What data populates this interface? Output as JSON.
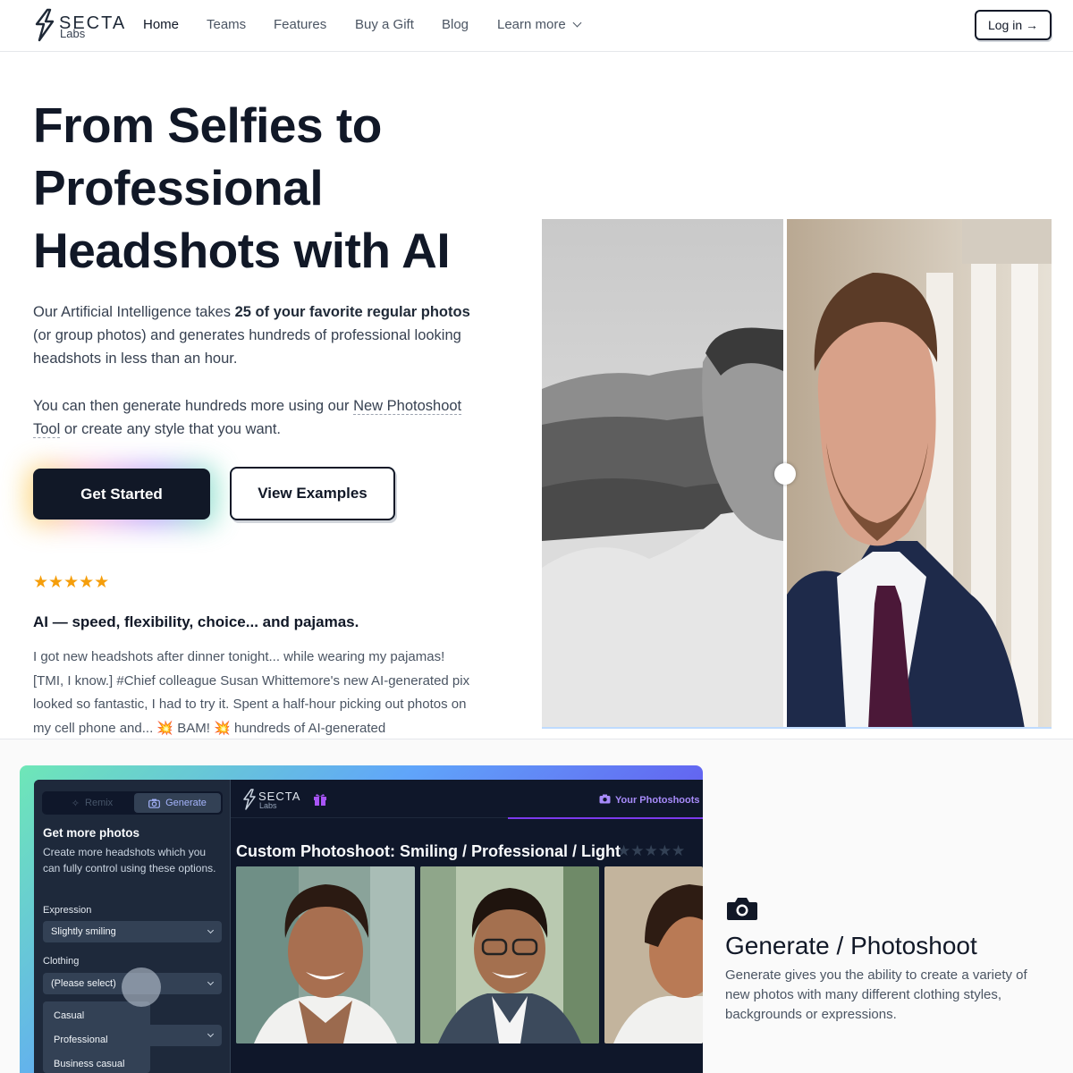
{
  "nav": {
    "logo_name": "SECTA",
    "logo_sub": "Labs",
    "links": [
      "Home",
      "Teams",
      "Features",
      "Buy a Gift",
      "Blog"
    ],
    "learn_more": "Learn more",
    "login": "Log in →"
  },
  "hero": {
    "title_line1": "From Selfies to",
    "title_line2": "Professional",
    "title_line3": "Headshots with AI",
    "p1_pre": "Our Artificial Intelligence takes ",
    "p1_bold": "25 of your favorite regular photos",
    "p1_post": " (or group photos) and generates hundreds of professional looking headshots in less than an hour.",
    "p2_pre": "You can then generate hundreds more using our ",
    "p2_link": "New Photoshoot Tool",
    "p2_post": " or create any style that you want.",
    "cta_primary": "Get Started",
    "cta_secondary": "View Examples"
  },
  "review": {
    "stars": "★★★★★",
    "rating": 5,
    "title": "AI — speed, flexibility, choice... and pajamas.",
    "body": "I got new headshots after dinner tonight... while wearing my pajamas! [TMI, I know.] #Chief colleague Susan Whittemore's new AI-generated pix looked so fantastic, I had to try it. Spent a half-hour picking out photos on my cell phone and... 💥 BAM! 💥 hundreds of AI-generated"
  },
  "app_preview": {
    "tab_remix": "Remix",
    "tab_generate": "Generate",
    "sidebar_title": "Get more photos",
    "sidebar_desc": "Create more headshots which you can fully control using these options.",
    "expression_label": "Expression",
    "expression_value": "Slightly smiling",
    "clothing_label": "Clothing",
    "clothing_value": "(Please select)",
    "clothing_options": [
      "Casual",
      "Professional",
      "Business casual"
    ],
    "logo_name": "SECTA",
    "logo_sub": "Labs",
    "your_photoshoots": "Your Photoshoots",
    "photoshoot_title": "Custom Photoshoot: Smiling / Professional / Light",
    "photoshoot_stars": "★★★★★"
  },
  "feature": {
    "icon": "camera-icon",
    "title": "Generate / Photoshoot",
    "desc": "Generate gives you the ability to create a variety of new photos with many different clothing styles, backgrounds or expressions."
  }
}
